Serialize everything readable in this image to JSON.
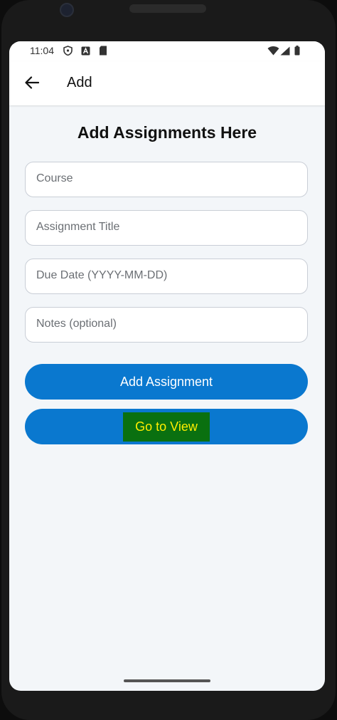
{
  "status_bar": {
    "time": "11:04",
    "left_icons": [
      "shield-icon",
      "font-badge-icon",
      "sd-card-icon"
    ],
    "right_icons": [
      "wifi-icon",
      "signal-icon",
      "battery-icon"
    ]
  },
  "app_bar": {
    "title": "Add",
    "back_icon": "arrow-left-icon"
  },
  "page": {
    "heading": "Add Assignments Here"
  },
  "form": {
    "course_placeholder": "Course",
    "title_placeholder": "Assignment Title",
    "due_date_placeholder": "Due Date (YYYY-MM-DD)",
    "notes_placeholder": "Notes (optional)"
  },
  "buttons": {
    "add_label": "Add Assignment",
    "view_label": "Go to View"
  },
  "colors": {
    "primary": "#0a78cf",
    "view_label_bg": "#0a7010",
    "view_label_text": "#ffee00",
    "background": "#f3f6f9"
  }
}
